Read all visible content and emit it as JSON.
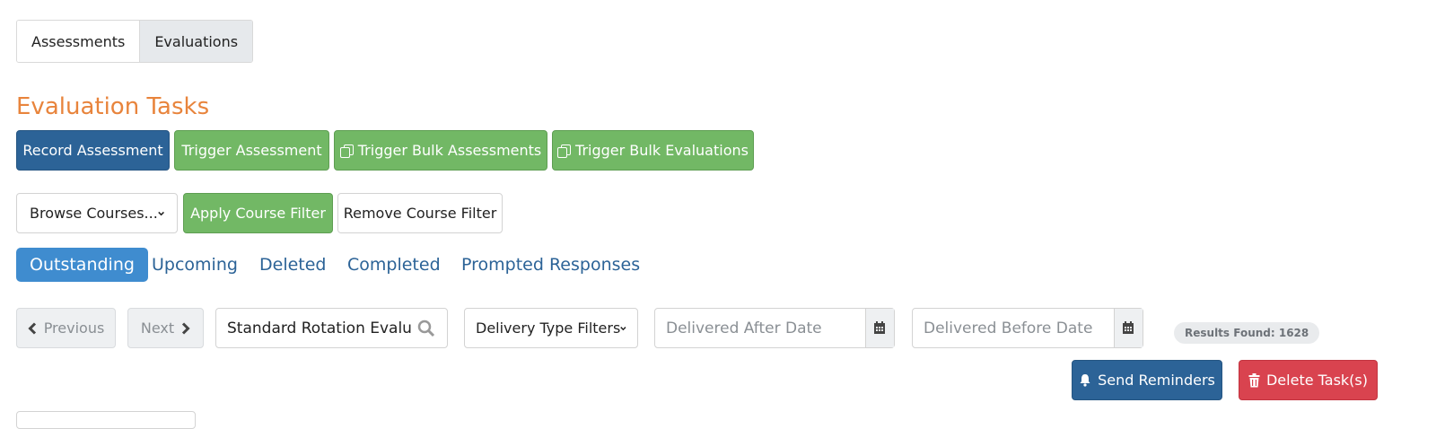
{
  "tabs": [
    {
      "label": "Assessments"
    },
    {
      "label": "Evaluations"
    }
  ],
  "page_title": "Evaluation Tasks",
  "actions": {
    "record": "Record Assessment",
    "trigger": "Trigger Assessment",
    "bulk_assessments": "Trigger Bulk Assessments",
    "bulk_evaluations": "Trigger Bulk Evaluations"
  },
  "course_filter": {
    "browse": "Browse Courses...",
    "apply": "Apply Course Filter",
    "remove": "Remove Course Filter"
  },
  "status_tabs": [
    {
      "label": "Outstanding",
      "active": true
    },
    {
      "label": "Upcoming"
    },
    {
      "label": "Deleted"
    },
    {
      "label": "Completed"
    },
    {
      "label": "Prompted Responses"
    }
  ],
  "pager": {
    "previous": "Previous",
    "next": "Next"
  },
  "search": {
    "value": "Standard Rotation Evaluat"
  },
  "delivery_filter": "Delivery Type Filters",
  "after_date": {
    "placeholder": "Delivered After Date"
  },
  "before_date": {
    "placeholder": "Delivered Before Date"
  },
  "results": "Results Found: 1628",
  "bottom_actions": {
    "reminders": "Send Reminders",
    "delete": "Delete Task(s)"
  },
  "colors": {
    "accent_title": "#e8843c",
    "primary": "#2c6397",
    "success": "#72b865",
    "danger": "#d9434f",
    "pill_active": "#3f8ccf"
  }
}
